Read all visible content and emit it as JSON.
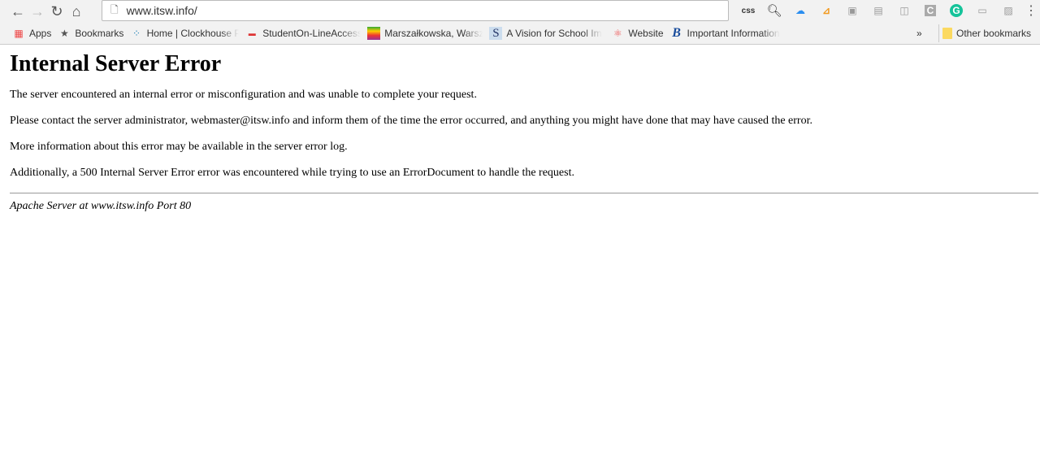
{
  "browser": {
    "url": "www.itsw.info/",
    "extensions": [
      "css-icon",
      "search-icon",
      "cloud-icon",
      "rss-icon",
      "translate-icon",
      "rss-grey-icon",
      "camera-icon",
      "c-icon",
      "grammarly-icon",
      "extension-icon",
      "pdf-icon"
    ],
    "ext_css_label": "css"
  },
  "bookmarks": {
    "items": [
      {
        "label": "Apps",
        "icon": "apps-grid-icon"
      },
      {
        "label": "Bookmarks",
        "icon": "star-icon"
      },
      {
        "label": "Home | Clockhouse Pr",
        "icon": "dots-icon"
      },
      {
        "label": "StudentOn-LineAccess",
        "icon": "sola-icon"
      },
      {
        "label": "Marszałkowska, Warsz",
        "icon": "rainbow-icon"
      },
      {
        "label": "A Vision for School Im",
        "icon": "s-icon"
      },
      {
        "label": "Website",
        "icon": "atom-icon"
      },
      {
        "label": "Important Information",
        "icon": "b-icon"
      }
    ],
    "overflow": "»",
    "other": "Other bookmarks"
  },
  "page": {
    "title": "Internal Server Error",
    "paragraphs": [
      "The server encountered an internal error or misconfiguration and was unable to complete your request.",
      "Please contact the server administrator, webmaster@itsw.info and inform them of the time the error occurred, and anything you might have done that may have caused the error.",
      "More information about this error may be available in the server error log.",
      "Additionally, a 500 Internal Server Error error was encountered while trying to use an ErrorDocument to handle the request."
    ],
    "address": "Apache Server at www.itsw.info Port 80"
  }
}
